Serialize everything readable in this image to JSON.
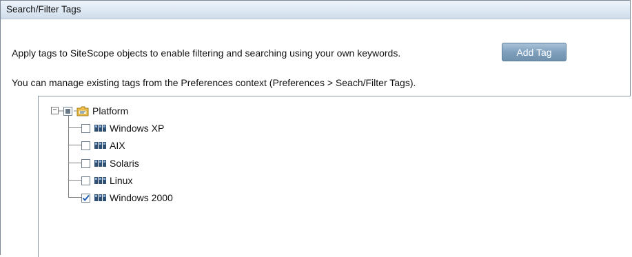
{
  "panel": {
    "title": "Search/Filter Tags"
  },
  "content": {
    "description": "Apply tags to SiteScope objects to enable filtering and searching using your own keywords.",
    "add_tag_label": "Add Tag",
    "manage_hint": "You can manage existing tags from the Preferences context (Preferences > Seach/Filter Tags)."
  },
  "tree": {
    "root": {
      "label": "Platform",
      "expanded": true,
      "check_state": "partial",
      "icon": "folder-icon"
    },
    "children": [
      {
        "label": "Windows XP",
        "checked": false,
        "icon": "tag-icon"
      },
      {
        "label": "AIX",
        "checked": false,
        "icon": "tag-icon"
      },
      {
        "label": "Solaris",
        "checked": false,
        "icon": "tag-icon"
      },
      {
        "label": "Linux",
        "checked": false,
        "icon": "tag-icon"
      },
      {
        "label": "Windows 2000",
        "checked": true,
        "icon": "tag-icon"
      }
    ]
  },
  "colors": {
    "title_bar": "#dde8f3",
    "button": "#7fa0bd",
    "check": "#1f5fb8"
  }
}
